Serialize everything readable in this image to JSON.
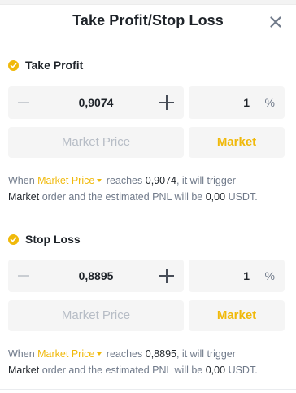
{
  "header": {
    "title": "Take Profit/Stop Loss"
  },
  "sections": [
    {
      "title": "Take Profit",
      "price_value": "0,9074",
      "percent_value": "1",
      "percent_unit": "%",
      "market_price_label": "Market Price",
      "market_label": "Market",
      "desc": {
        "when": "When",
        "trigger_link": "Market Price",
        "reaches": "reaches",
        "price": "0,9074",
        "trigger_text": ", it will trigger",
        "order_type": "Market",
        "order_text": "order and the estimated PNL will be",
        "pnl": "0,00",
        "currency": "USDT."
      }
    },
    {
      "title": "Stop Loss",
      "price_value": "0,8895",
      "percent_value": "1",
      "percent_unit": "%",
      "market_price_label": "Market Price",
      "market_label": "Market",
      "desc": {
        "when": "When",
        "trigger_link": "Market Price",
        "reaches": "reaches",
        "price": "0,8895",
        "trigger_text": ", it will trigger",
        "order_type": "Market",
        "order_text": "order and the estimated PNL will be",
        "pnl": "0,00",
        "currency": "USDT."
      }
    }
  ],
  "icons": {
    "close": "close-icon",
    "check": "check-icon",
    "plus": "plus-icon",
    "minus": "minus-icon",
    "caret": "caret-down-icon"
  },
  "colors": {
    "accent": "#f0b90b",
    "text": "#1e2329",
    "muted": "#707a8a",
    "disabled": "#b7bdc6",
    "field_bg": "#f5f5f5"
  }
}
